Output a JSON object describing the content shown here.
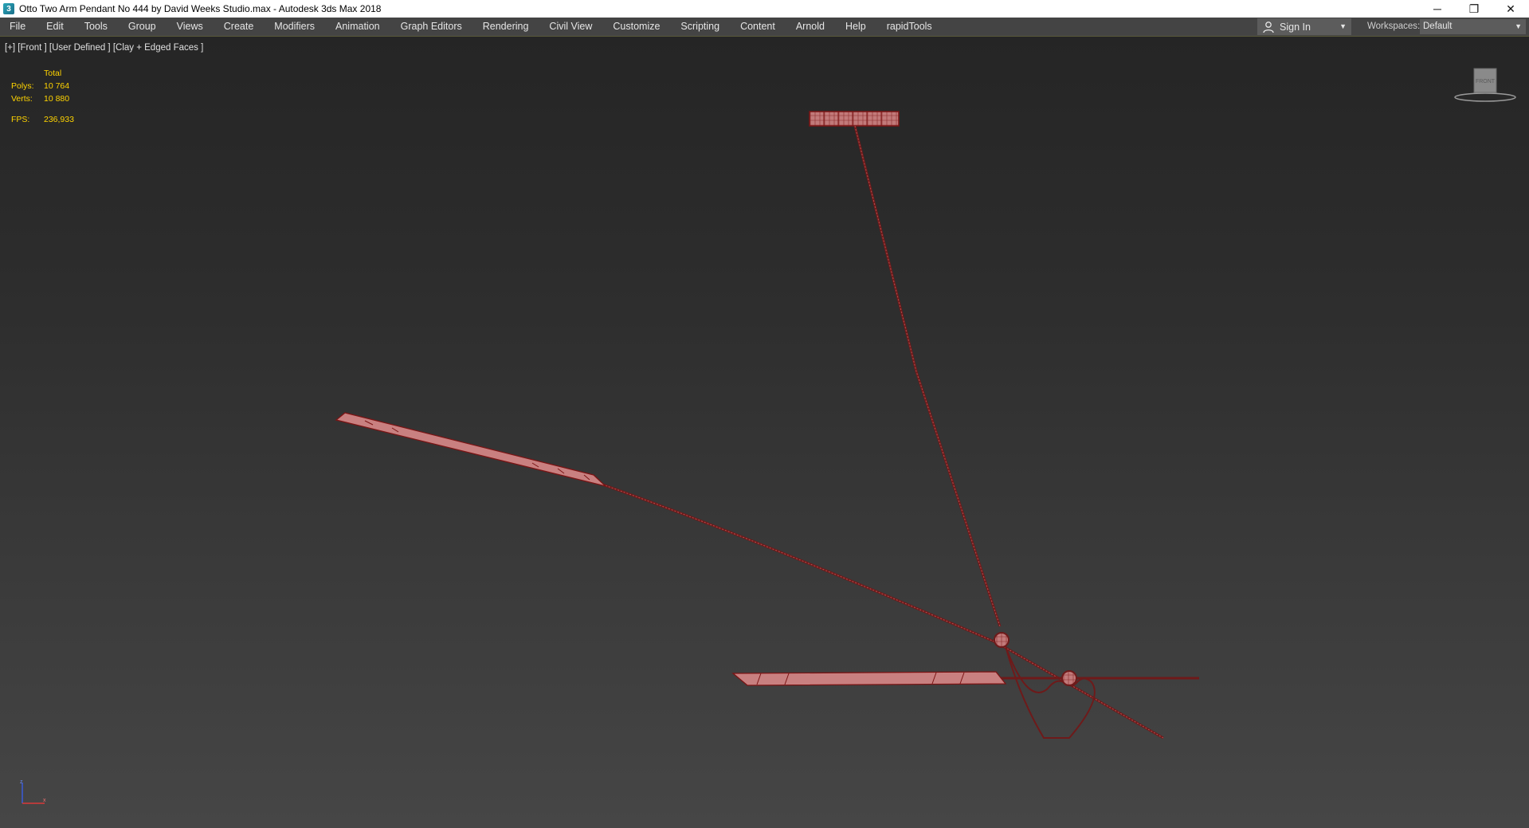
{
  "window": {
    "title": "Otto Two Arm Pendant No 444 by David Weeks Studio.max - Autodesk 3ds Max 2018",
    "app_icon_glyph": "3",
    "minimize_glyph": "─",
    "restore_glyph": "❐",
    "close_glyph": "✕"
  },
  "menu": {
    "items": [
      "File",
      "Edit",
      "Tools",
      "Group",
      "Views",
      "Create",
      "Modifiers",
      "Animation",
      "Graph Editors",
      "Rendering",
      "Civil View",
      "Customize",
      "Scripting",
      "Content",
      "Arnold",
      "Help",
      "rapidTools"
    ]
  },
  "account": {
    "signin_label": "Sign In",
    "signin_icon": "user-icon",
    "dropdown_caret": "▼"
  },
  "workspaces": {
    "label": "Workspaces:",
    "value": "Default",
    "caret": "▼"
  },
  "viewport": {
    "label": "[+] [Front ] [User Defined ] [Clay + Edged Faces ]",
    "stats": {
      "total_label": "Total",
      "polys_label": "Polys:",
      "polys_value": "10 764",
      "verts_label": "Verts:",
      "verts_value": "10 880",
      "fps_label": "FPS:",
      "fps_value": "236,933"
    },
    "viewcube_face": "FRONT",
    "gizmo_axis_x": "x",
    "gizmo_axis_z": "z"
  },
  "colors": {
    "model_fill": "#c98080",
    "model_edge": "#7a1414",
    "stats_text": "#ffd400"
  }
}
